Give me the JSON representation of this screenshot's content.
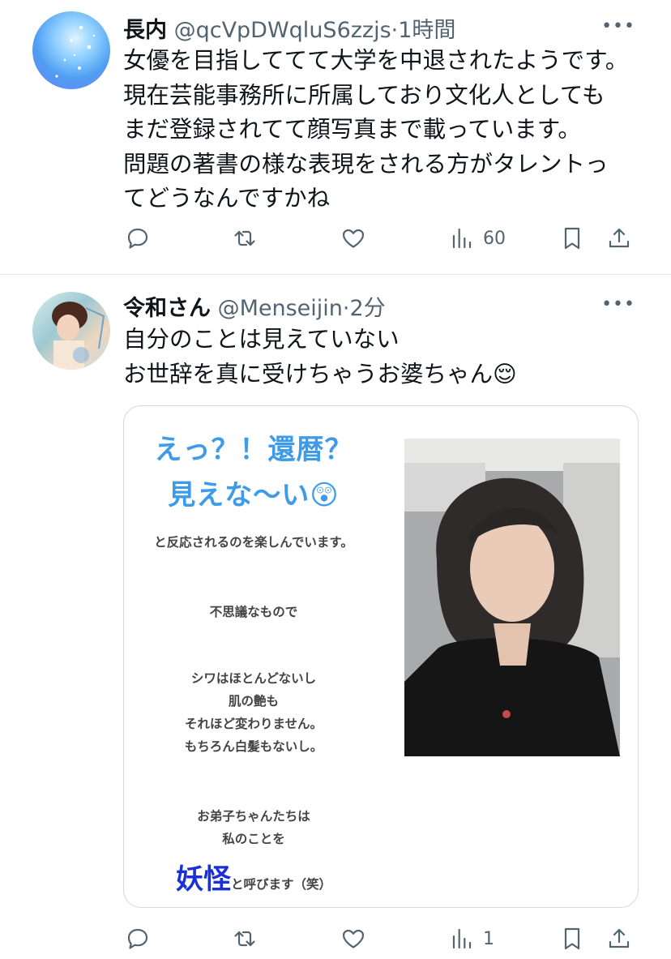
{
  "tweets": [
    {
      "display_name": "長内",
      "handle": "@qcVpDWqluS6zzjs",
      "separator": "·",
      "time": "1時間",
      "lines": [
        "女優を目指しててて大学を中退されたようです。",
        "現在芸能事務所に所属しており文化人としても",
        "まだ登録されてて顔写真まで載っています。",
        "問題の著書の様な表現をされる方がタレントっ",
        "てどうなんですかね"
      ],
      "views": "60"
    },
    {
      "display_name": "令和さん",
      "handle": "@Menseijin",
      "separator": "·",
      "time": "2分",
      "lines": [
        "自分のことは見えていない",
        "お世辞を真に受けちゃうお婆ちゃん😌"
      ],
      "views": "1",
      "card": {
        "headline1": "えっ？！還暦？",
        "headline2": "見えな〜い😲",
        "reaction": "と反応されるのを楽しんでいます。",
        "p1": "不思議なもので",
        "p2_lines": [
          "シワはほとんどないし",
          "肌の艶も",
          "それほど変わりません。",
          "もちろん白髪もないし。"
        ],
        "p3_lines": [
          "お弟子ちゃんたちは",
          "私のことを"
        ],
        "yokai": "妖怪",
        "yokai_suffix": "と呼びます（笑）"
      }
    }
  ],
  "more_label": "•••",
  "icons": [
    "reply-icon",
    "retweet-icon",
    "like-icon",
    "views-icon",
    "bookmark-icon",
    "share-icon"
  ],
  "colors": {
    "accent_text": "#3d9be9",
    "yokai_text": "#1a2fd6",
    "meta": "#536471"
  }
}
